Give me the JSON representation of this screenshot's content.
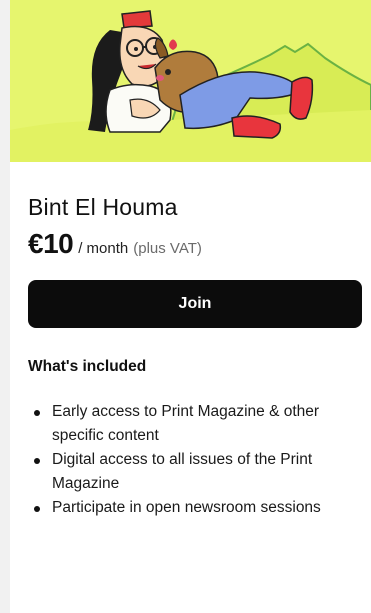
{
  "plan": {
    "title": "Bint El Houma",
    "price": "€10",
    "period": "/ month",
    "vat_note": "(plus VAT)",
    "join_label": "Join"
  },
  "included": {
    "heading": "What's included",
    "items": [
      "Early access to Print Magazine & other specific content",
      "Digital access to all issues of the Print Magazine",
      "Participate in open newsroom sessions"
    ]
  },
  "colors": {
    "hero_background": "#e6f56e",
    "button_background": "#0c0c0c",
    "button_text": "#ffffff"
  }
}
